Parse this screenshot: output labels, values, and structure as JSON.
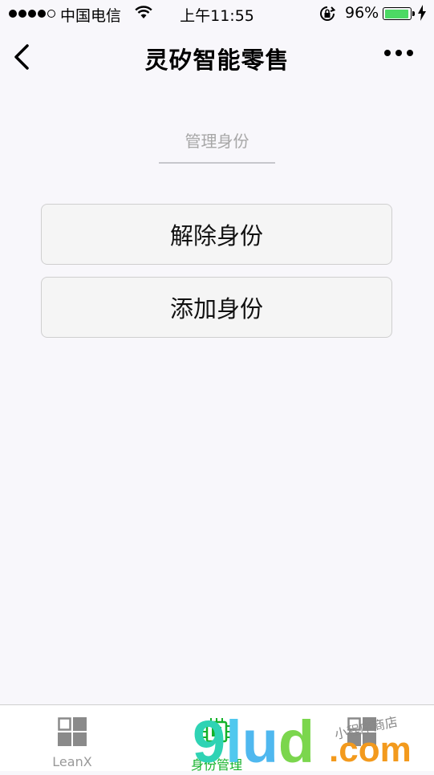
{
  "status_bar": {
    "carrier": "中国电信",
    "time": "上午11:55",
    "battery_percent": "96%",
    "battery_level": 0.96,
    "signal_bars": 4,
    "signal_max": 5
  },
  "nav": {
    "title": "灵矽智能零售"
  },
  "main": {
    "section_title": "管理身份",
    "remove_button_label": "解除身份",
    "add_button_label": "添加身份"
  },
  "tabbar": {
    "tabs": [
      {
        "label": "LeanX",
        "icon": "grid-icon"
      },
      {
        "label": "身份管理",
        "icon": "chip-icon"
      },
      {
        "label": "",
        "icon": "grid-icon"
      }
    ]
  },
  "watermark": {
    "brand": "9lud",
    "suffix": ".com",
    "tagline": "小程序商店"
  },
  "colors": {
    "accent": "#13b22a",
    "battery": "#4cd964",
    "background": "#f8f7fb"
  }
}
